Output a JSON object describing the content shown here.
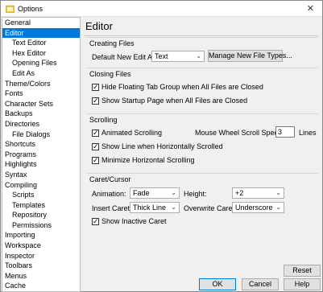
{
  "window": {
    "title": "Options",
    "close_glyph": "✕"
  },
  "sidebar": {
    "items": [
      {
        "label": "General",
        "level": 0,
        "selected": false
      },
      {
        "label": "Editor",
        "level": 0,
        "selected": true
      },
      {
        "label": "Text Editor",
        "level": 1,
        "selected": false
      },
      {
        "label": "Hex Editor",
        "level": 1,
        "selected": false
      },
      {
        "label": "Opening Files",
        "level": 1,
        "selected": false
      },
      {
        "label": "Edit As",
        "level": 1,
        "selected": false
      },
      {
        "label": "Theme/Colors",
        "level": 0,
        "selected": false
      },
      {
        "label": "Fonts",
        "level": 0,
        "selected": false
      },
      {
        "label": "Character Sets",
        "level": 0,
        "selected": false
      },
      {
        "label": "Backups",
        "level": 0,
        "selected": false
      },
      {
        "label": "Directories",
        "level": 0,
        "selected": false
      },
      {
        "label": "File Dialogs",
        "level": 1,
        "selected": false
      },
      {
        "label": "Shortcuts",
        "level": 0,
        "selected": false
      },
      {
        "label": "Programs",
        "level": 0,
        "selected": false
      },
      {
        "label": "Highlights",
        "level": 0,
        "selected": false
      },
      {
        "label": "Syntax",
        "level": 0,
        "selected": false
      },
      {
        "label": "Compiling",
        "level": 0,
        "selected": false
      },
      {
        "label": "Scripts",
        "level": 1,
        "selected": false
      },
      {
        "label": "Templates",
        "level": 1,
        "selected": false
      },
      {
        "label": "Repository",
        "level": 1,
        "selected": false
      },
      {
        "label": "Permissions",
        "level": 1,
        "selected": false
      },
      {
        "label": "Importing",
        "level": 0,
        "selected": false
      },
      {
        "label": "Workspace",
        "level": 0,
        "selected": false
      },
      {
        "label": "Inspector",
        "level": 0,
        "selected": false
      },
      {
        "label": "Toolbars",
        "level": 0,
        "selected": false
      },
      {
        "label": "Menus",
        "level": 0,
        "selected": false
      },
      {
        "label": "Cache",
        "level": 0,
        "selected": false
      }
    ]
  },
  "main": {
    "heading": "Editor",
    "creating": {
      "title": "Creating Files",
      "default_label": "Default New Edit As:",
      "default_value": "Text",
      "manage_button": "Manage New File Types..."
    },
    "closing": {
      "title": "Closing Files",
      "hide_floating": {
        "label": "Hide Floating Tab Group when All Files are Closed",
        "checked": true
      },
      "show_startup": {
        "label": "Show Startup Page when All Files are Closed",
        "checked": true
      }
    },
    "scrolling": {
      "title": "Scrolling",
      "animated": {
        "label": "Animated Scrolling",
        "checked": true
      },
      "wheel_label": "Mouse Wheel Scroll Speed:",
      "wheel_value": "3",
      "wheel_unit": "Lines",
      "show_line": {
        "label": "Show Line when Horizontally Scrolled",
        "checked": true
      },
      "minimize": {
        "label": "Minimize Horizontal Scrolling",
        "checked": true
      }
    },
    "caret": {
      "title": "Caret/Cursor",
      "animation_label": "Animation:",
      "animation_value": "Fade",
      "height_label": "Height:",
      "height_value": "+2",
      "insert_label": "Insert Caret:",
      "insert_value": "Thick Line",
      "overwrite_label": "Overwrite Caret:",
      "overwrite_value": "Underscore",
      "show_inactive": {
        "label": "Show Inactive Caret",
        "checked": true
      }
    }
  },
  "buttons": {
    "reset": "Reset",
    "ok": "OK",
    "cancel": "Cancel",
    "help": "Help"
  },
  "glyphs": {
    "check": "✓",
    "dropdown": "⌄"
  },
  "colors": {
    "selection": "#0078d7",
    "icon_yellow": "#f4c23c"
  }
}
